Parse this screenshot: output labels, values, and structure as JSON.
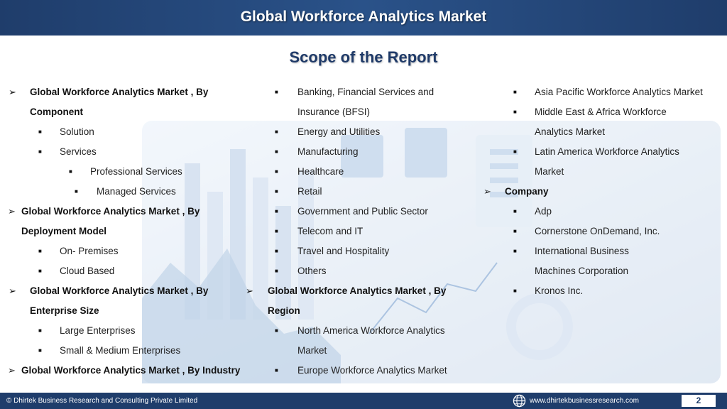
{
  "header": {
    "title": "Global Workforce Analytics Market"
  },
  "subtitle": "Scope of the Report",
  "content": {
    "col1": [
      "Global Workforce Analytics Market , By",
      "Component",
      "Solution",
      "Services",
      "Professional Services",
      "Managed Services",
      "Global Workforce Analytics Market , By",
      "Deployment Model",
      "On- Premises",
      "Cloud Based",
      "Global Workforce Analytics Market , By",
      "Enterprise Size",
      "Large Enterprises",
      "Small & Medium Enterprises",
      "Global Workforce Analytics Market , By Industry"
    ],
    "col2": [
      "Banking, Financial Services and",
      "Insurance (BFSI)",
      "Energy and Utilities",
      "Manufacturing",
      "Healthcare",
      "Retail",
      "Government and Public Sector",
      "Telecom and IT",
      "Travel and Hospitality",
      "Others",
      "Global Workforce Analytics Market , By",
      "Region",
      "North America Workforce Analytics",
      "Market",
      "Europe Workforce Analytics Market"
    ],
    "col3": [
      "Asia Pacific Workforce Analytics Market",
      "Middle East & Africa Workforce",
      "Analytics Market",
      "Latin America Workforce Analytics",
      "Market",
      "Company",
      "Adp",
      "Cornerstone OnDemand, Inc.",
      "International Business",
      "Machines Corporation",
      "Kronos Inc."
    ]
  },
  "footer": {
    "copyright": "© Dhirtek Business Research and Consulting Private Limited",
    "website": "www.dhirtekbusinessresearch.com",
    "page": "2"
  },
  "icons": {
    "arrow_bullet": "➢",
    "square_bullet": "■",
    "globe": "globe-icon"
  },
  "colors": {
    "header_bg": "#1f3d6b",
    "subtitle": "#1f3a68",
    "footer_bg": "#1f3d6b"
  }
}
